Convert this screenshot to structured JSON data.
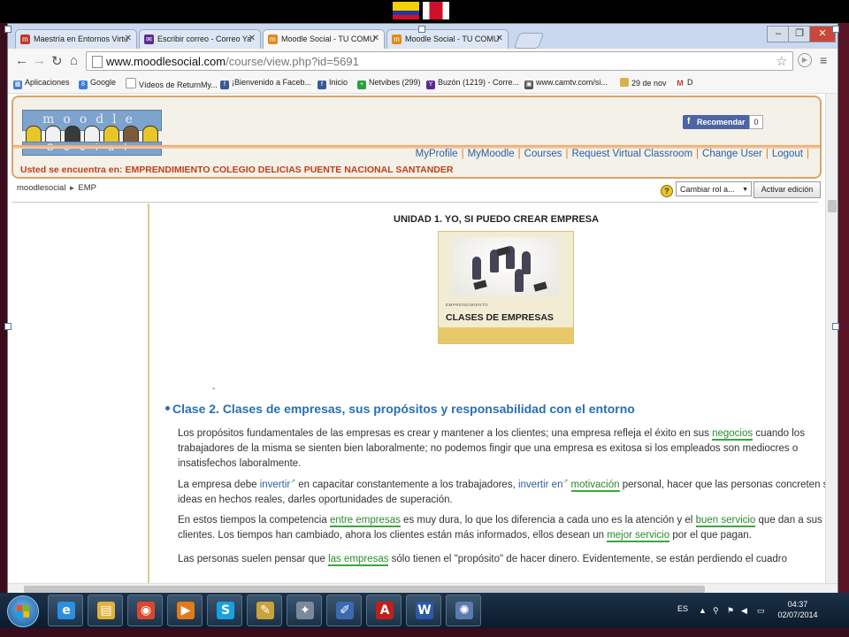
{
  "browser": {
    "tabs": [
      {
        "label": "Maestría en Entornos Virtu",
        "icon": "moodle-tab-icon",
        "color": "#c0392b"
      },
      {
        "label": "Escribir correo - Correo Ya",
        "icon": "yahoo-mail-icon",
        "color": "#5b2a91"
      },
      {
        "label": "Moodle Social - TU COMU",
        "icon": "moodle-tab-icon",
        "color": "#e08a1a"
      },
      {
        "label": "Moodle Social - TU COMU",
        "icon": "moodle-tab-icon",
        "color": "#e08a1a"
      }
    ],
    "url_host": "www.moodlesocial.com",
    "url_path": "/course/view.php?id=5691",
    "bookmarks": [
      {
        "label": "Aplicaciones",
        "color": "#4a7bd0"
      },
      {
        "label": "Google",
        "color": "#3b7de0"
      },
      {
        "label": "Vídeos de ReturnMy...",
        "color": "#888888"
      },
      {
        "label": "¡Bienvenido a Faceb...",
        "color": "#3b5998"
      },
      {
        "label": "Inicio",
        "color": "#3b5998"
      },
      {
        "label": "Netvibes (299)",
        "color": "#2e9e3e"
      },
      {
        "label": "Buzón (1219) - Corre...",
        "color": "#5b2a91"
      },
      {
        "label": "www.camtv.com/si...",
        "color": "#555555"
      },
      {
        "label": "29 de nov",
        "color": "#d8b24a"
      },
      {
        "label": "D",
        "color": "#c0392b"
      }
    ]
  },
  "moodle": {
    "logo_top": "moodle",
    "logo_bottom": "Social",
    "fb_label": "Recomendar",
    "fb_count": "0",
    "nav": [
      "MyProfile",
      "MyMoodle",
      "Courses",
      "Request Virtual Classroom",
      "Change User",
      "Logout"
    ],
    "location": "Usted se encuentra en: EMPRENDIMIENTO COLEGIO DELICIAS PUENTE NACIONAL SANTANDER",
    "breadcrumb_home": "moodlesocial",
    "breadcrumb_course": "EMP",
    "role_select": "Cambiar rol a...",
    "edit_button": "Activar edición"
  },
  "content": {
    "unit_title": "UNIDAD 1. YO, SI  PUEDO CREAR EMPRESA",
    "image_small": "EMPRENDIMIENTO",
    "image_caption": "CLASES DE EMPRESAS",
    "dash": "-",
    "clase_title": "Clase 2. Clases de empresas, sus propósitos y  responsabilidad con el entorno",
    "p1": {
      "a": "Los propósitos fundamentales de las empresas es crear y mantener a los clientes; una empresa refleja el éxito en sus ",
      "link": "negocios",
      "b": " cuando los trabajadores de la misma se sienten bien laboralmente; no podemos fingir que una empresa es exitosa si los empleados son mediocres o insatisfechos laboralmente."
    },
    "p2": {
      "a": "La empresa debe ",
      "link1": "invertir",
      "b": " en capacitar constantemente a los trabajadores, ",
      "link2": "invertir en",
      "c": " ",
      "link3": "motivación",
      "d": " personal, hacer que las personas concreten sus ideas en hechos reales, darles oportunidades de superación."
    },
    "p3": {
      "a": "En estos tiempos la competencia ",
      "link1": "entre empresas",
      "b": " es muy dura, lo que los diferencia a cada uno es la atención y el ",
      "link2": "buen servicio",
      "c": " que dan a sus clientes. Los tiempos han cambiado, ahora los clientes están más informados, ellos desean un ",
      "link3": "mejor servicio",
      "d": " por el que pagan."
    },
    "p4": {
      "a": "Las personas suelen pensar que ",
      "link": "las empresas",
      "b": " sólo tienen el \"propósito\" de hacer dinero. Evidentemente, se están perdiendo el cuadro"
    }
  },
  "taskbar": {
    "apps": [
      {
        "name": "internet-explorer-icon",
        "glyph": "e",
        "color": "#2a8fe0"
      },
      {
        "name": "file-explorer-icon",
        "glyph": "▤",
        "color": "#e0b23a"
      },
      {
        "name": "chrome-icon",
        "glyph": "◉",
        "color": "#d9482b"
      },
      {
        "name": "media-player-icon",
        "glyph": "▶",
        "color": "#e07a1a"
      },
      {
        "name": "skype-icon",
        "glyph": "S",
        "color": "#1aa0e0"
      },
      {
        "name": "paint-icon",
        "glyph": "✎",
        "color": "#c9a23a"
      },
      {
        "name": "gimp-icon",
        "glyph": "✦",
        "color": "#7a8a9a"
      },
      {
        "name": "editor-icon",
        "glyph": "✐",
        "color": "#3a6ab0"
      },
      {
        "name": "adobe-reader-icon",
        "glyph": "A",
        "color": "#c0201a"
      },
      {
        "name": "word-icon",
        "glyph": "W",
        "color": "#2a5aa8"
      },
      {
        "name": "photo-editor-icon",
        "glyph": "✺",
        "color": "#5a7ab0"
      }
    ],
    "lang": "ES",
    "time": "04:37",
    "date": "02/07/2014"
  }
}
